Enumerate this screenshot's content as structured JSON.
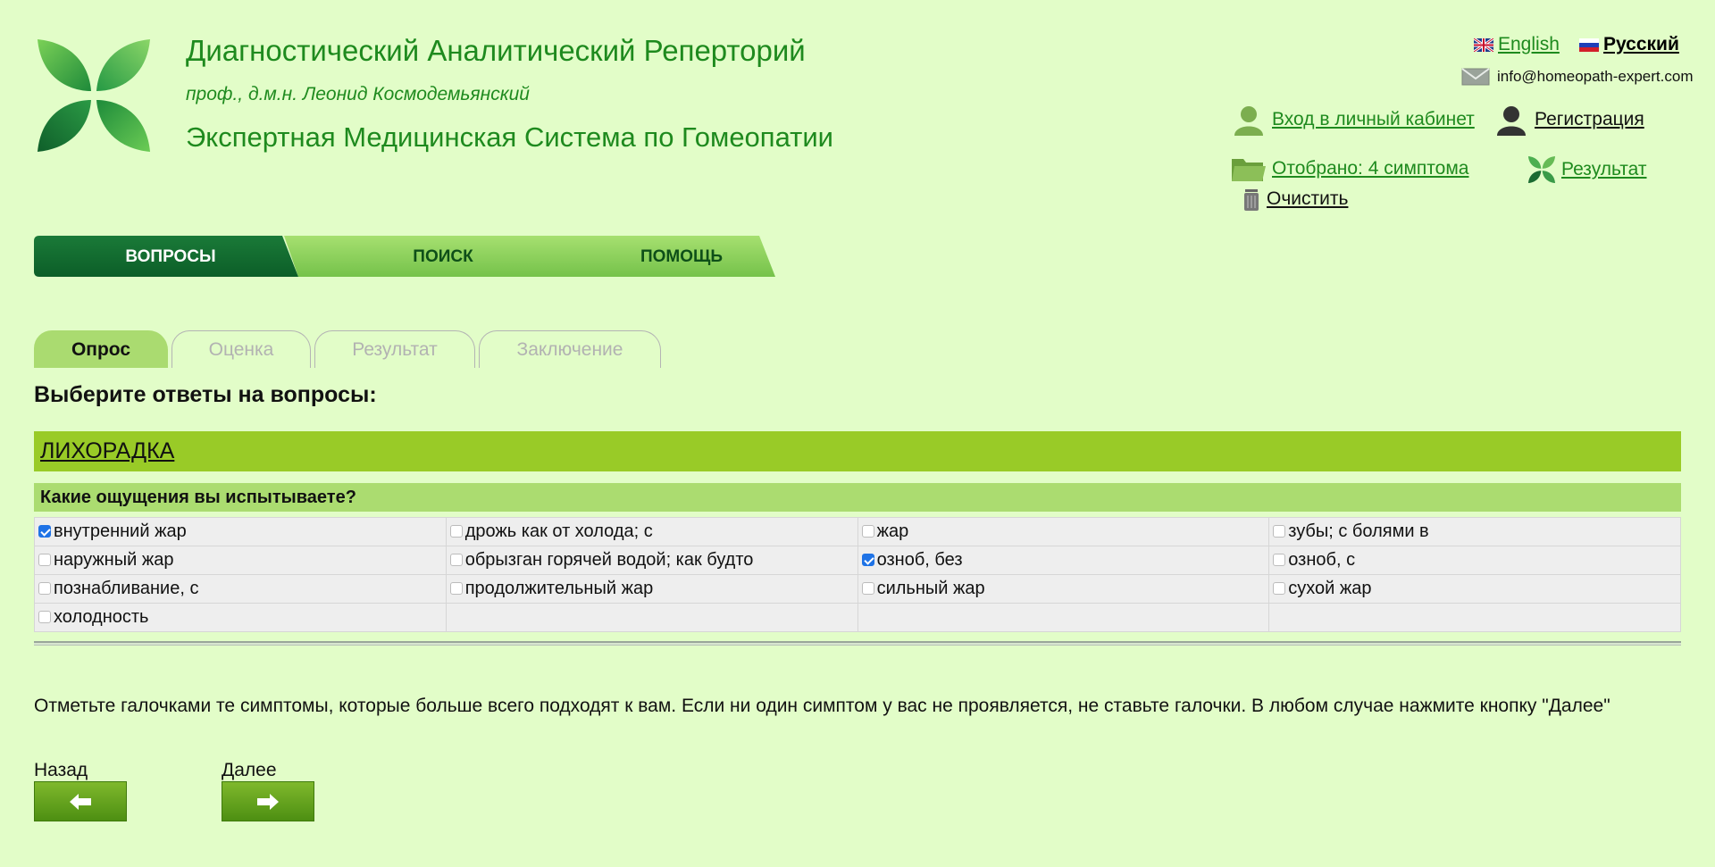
{
  "header": {
    "title": "Диагностический Аналитический Реперторий",
    "author": "проф., д.м.н. Леонид Космодемьянский",
    "subtitle": "Экспертная Медицинская Система по Гомеопатии"
  },
  "languages": [
    {
      "label": " English",
      "active": false
    },
    {
      "label": " Русский",
      "active": true
    }
  ],
  "email": "info@homeopath-expert.com",
  "account": {
    "login": "Вход в личный кабинет",
    "register": "Регистрация"
  },
  "selection": {
    "selected": "Отобрано: 4 симптома",
    "result": "Результат",
    "clear": "Очистить"
  },
  "main_nav": [
    "ВОПРОСЫ",
    "ПОИСК",
    "ПОМОЩЬ"
  ],
  "sub_tabs": [
    "Опрос",
    "Оценка",
    "Результат",
    "Заключение"
  ],
  "page_heading": "Выберите ответы на вопросы:",
  "section": "ЛИХОРАДКА",
  "question": "Какие ощущения вы испытываете?",
  "options": [
    [
      {
        "label": "внутренний жар",
        "checked": true
      },
      {
        "label": "дрожь как от холода; с",
        "checked": false
      },
      {
        "label": "жар",
        "checked": false
      },
      {
        "label": "зубы; с болями в",
        "checked": false
      }
    ],
    [
      {
        "label": "наружный жар",
        "checked": false
      },
      {
        "label": "обрызган горячей водой; как будто",
        "checked": false
      },
      {
        "label": "озноб, без",
        "checked": true
      },
      {
        "label": "озноб, с",
        "checked": false
      }
    ],
    [
      {
        "label": "познабливание, с",
        "checked": false
      },
      {
        "label": "продолжительный жар",
        "checked": false
      },
      {
        "label": "сильный жар",
        "checked": false
      },
      {
        "label": "сухой жар",
        "checked": false
      }
    ],
    [
      {
        "label": "холодность",
        "checked": false
      }
    ]
  ],
  "note": "Отметьте галочками те симптомы, которые больше всего подходят к вам. Если ни один симптом у вас не проявляется, не ставьте галочки. В любом случае нажмите кнопку \"Далее\"",
  "buttons": {
    "back_label": "Назад",
    "next_label": "Далее"
  },
  "colors": {
    "background": "#e2fdc8",
    "brand_green": "#1e8a1e",
    "section_bar": "#99cb27",
    "question_bar": "#abdc70",
    "nav_active": "#0f6b2c"
  },
  "icons": [
    "logo-leaves",
    "uk-flag-icon",
    "russia-flag-icon",
    "envelope-icon",
    "user-icon",
    "user-add-icon",
    "folder-icon",
    "leaf-result-icon",
    "trash-icon",
    "arrow-left-icon",
    "arrow-right-icon"
  ]
}
